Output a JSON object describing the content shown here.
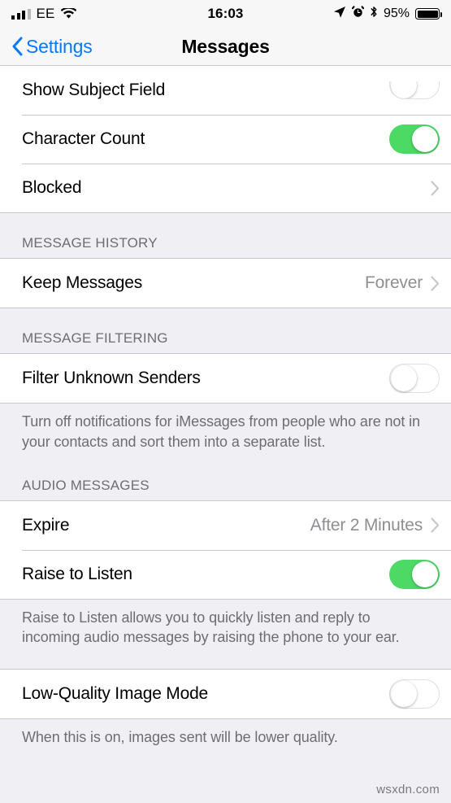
{
  "status_bar": {
    "carrier": "EE",
    "time": "16:03",
    "battery_percent": "95%",
    "icons": [
      "signal-bars-icon",
      "wifi-icon",
      "location-arrow-icon",
      "alarm-clock-icon",
      "bluetooth-icon",
      "battery-icon"
    ]
  },
  "nav": {
    "back_label": "Settings",
    "title": "Messages"
  },
  "sections": [
    {
      "header": "",
      "rows": [
        {
          "label": "Show Subject Field",
          "type": "toggle",
          "value": "off",
          "clipped": true
        },
        {
          "label": "Character Count",
          "type": "toggle",
          "value": "on"
        },
        {
          "label": "Blocked",
          "type": "disclosure",
          "value": ""
        }
      ],
      "footer": ""
    },
    {
      "header": "MESSAGE HISTORY",
      "rows": [
        {
          "label": "Keep Messages",
          "type": "value",
          "value": "Forever"
        }
      ],
      "footer": ""
    },
    {
      "header": "MESSAGE FILTERING",
      "rows": [
        {
          "label": "Filter Unknown Senders",
          "type": "toggle",
          "value": "off"
        }
      ],
      "footer": "Turn off notifications for iMessages from people who are not in your contacts and sort them into a separate list."
    },
    {
      "header": "AUDIO MESSAGES",
      "rows": [
        {
          "label": "Expire",
          "type": "value",
          "value": "After 2 Minutes"
        },
        {
          "label": "Raise to Listen",
          "type": "toggle",
          "value": "on"
        }
      ],
      "footer": "Raise to Listen allows you to quickly listen and reply to incoming audio messages by raising the phone to your ear."
    },
    {
      "header": "",
      "rows": [
        {
          "label": "Low-Quality Image Mode",
          "type": "toggle",
          "value": "off"
        }
      ],
      "footer": "When this is on, images sent will be lower quality."
    }
  ],
  "watermark": "wsxdn.com",
  "colors": {
    "accent_blue": "#007AFF",
    "toggle_on_green": "#4CD964",
    "background_grey": "#EFEFF4",
    "separator": "#C8C7CC",
    "secondary_text": "#8E8E93",
    "header_text": "#6D6D72"
  }
}
